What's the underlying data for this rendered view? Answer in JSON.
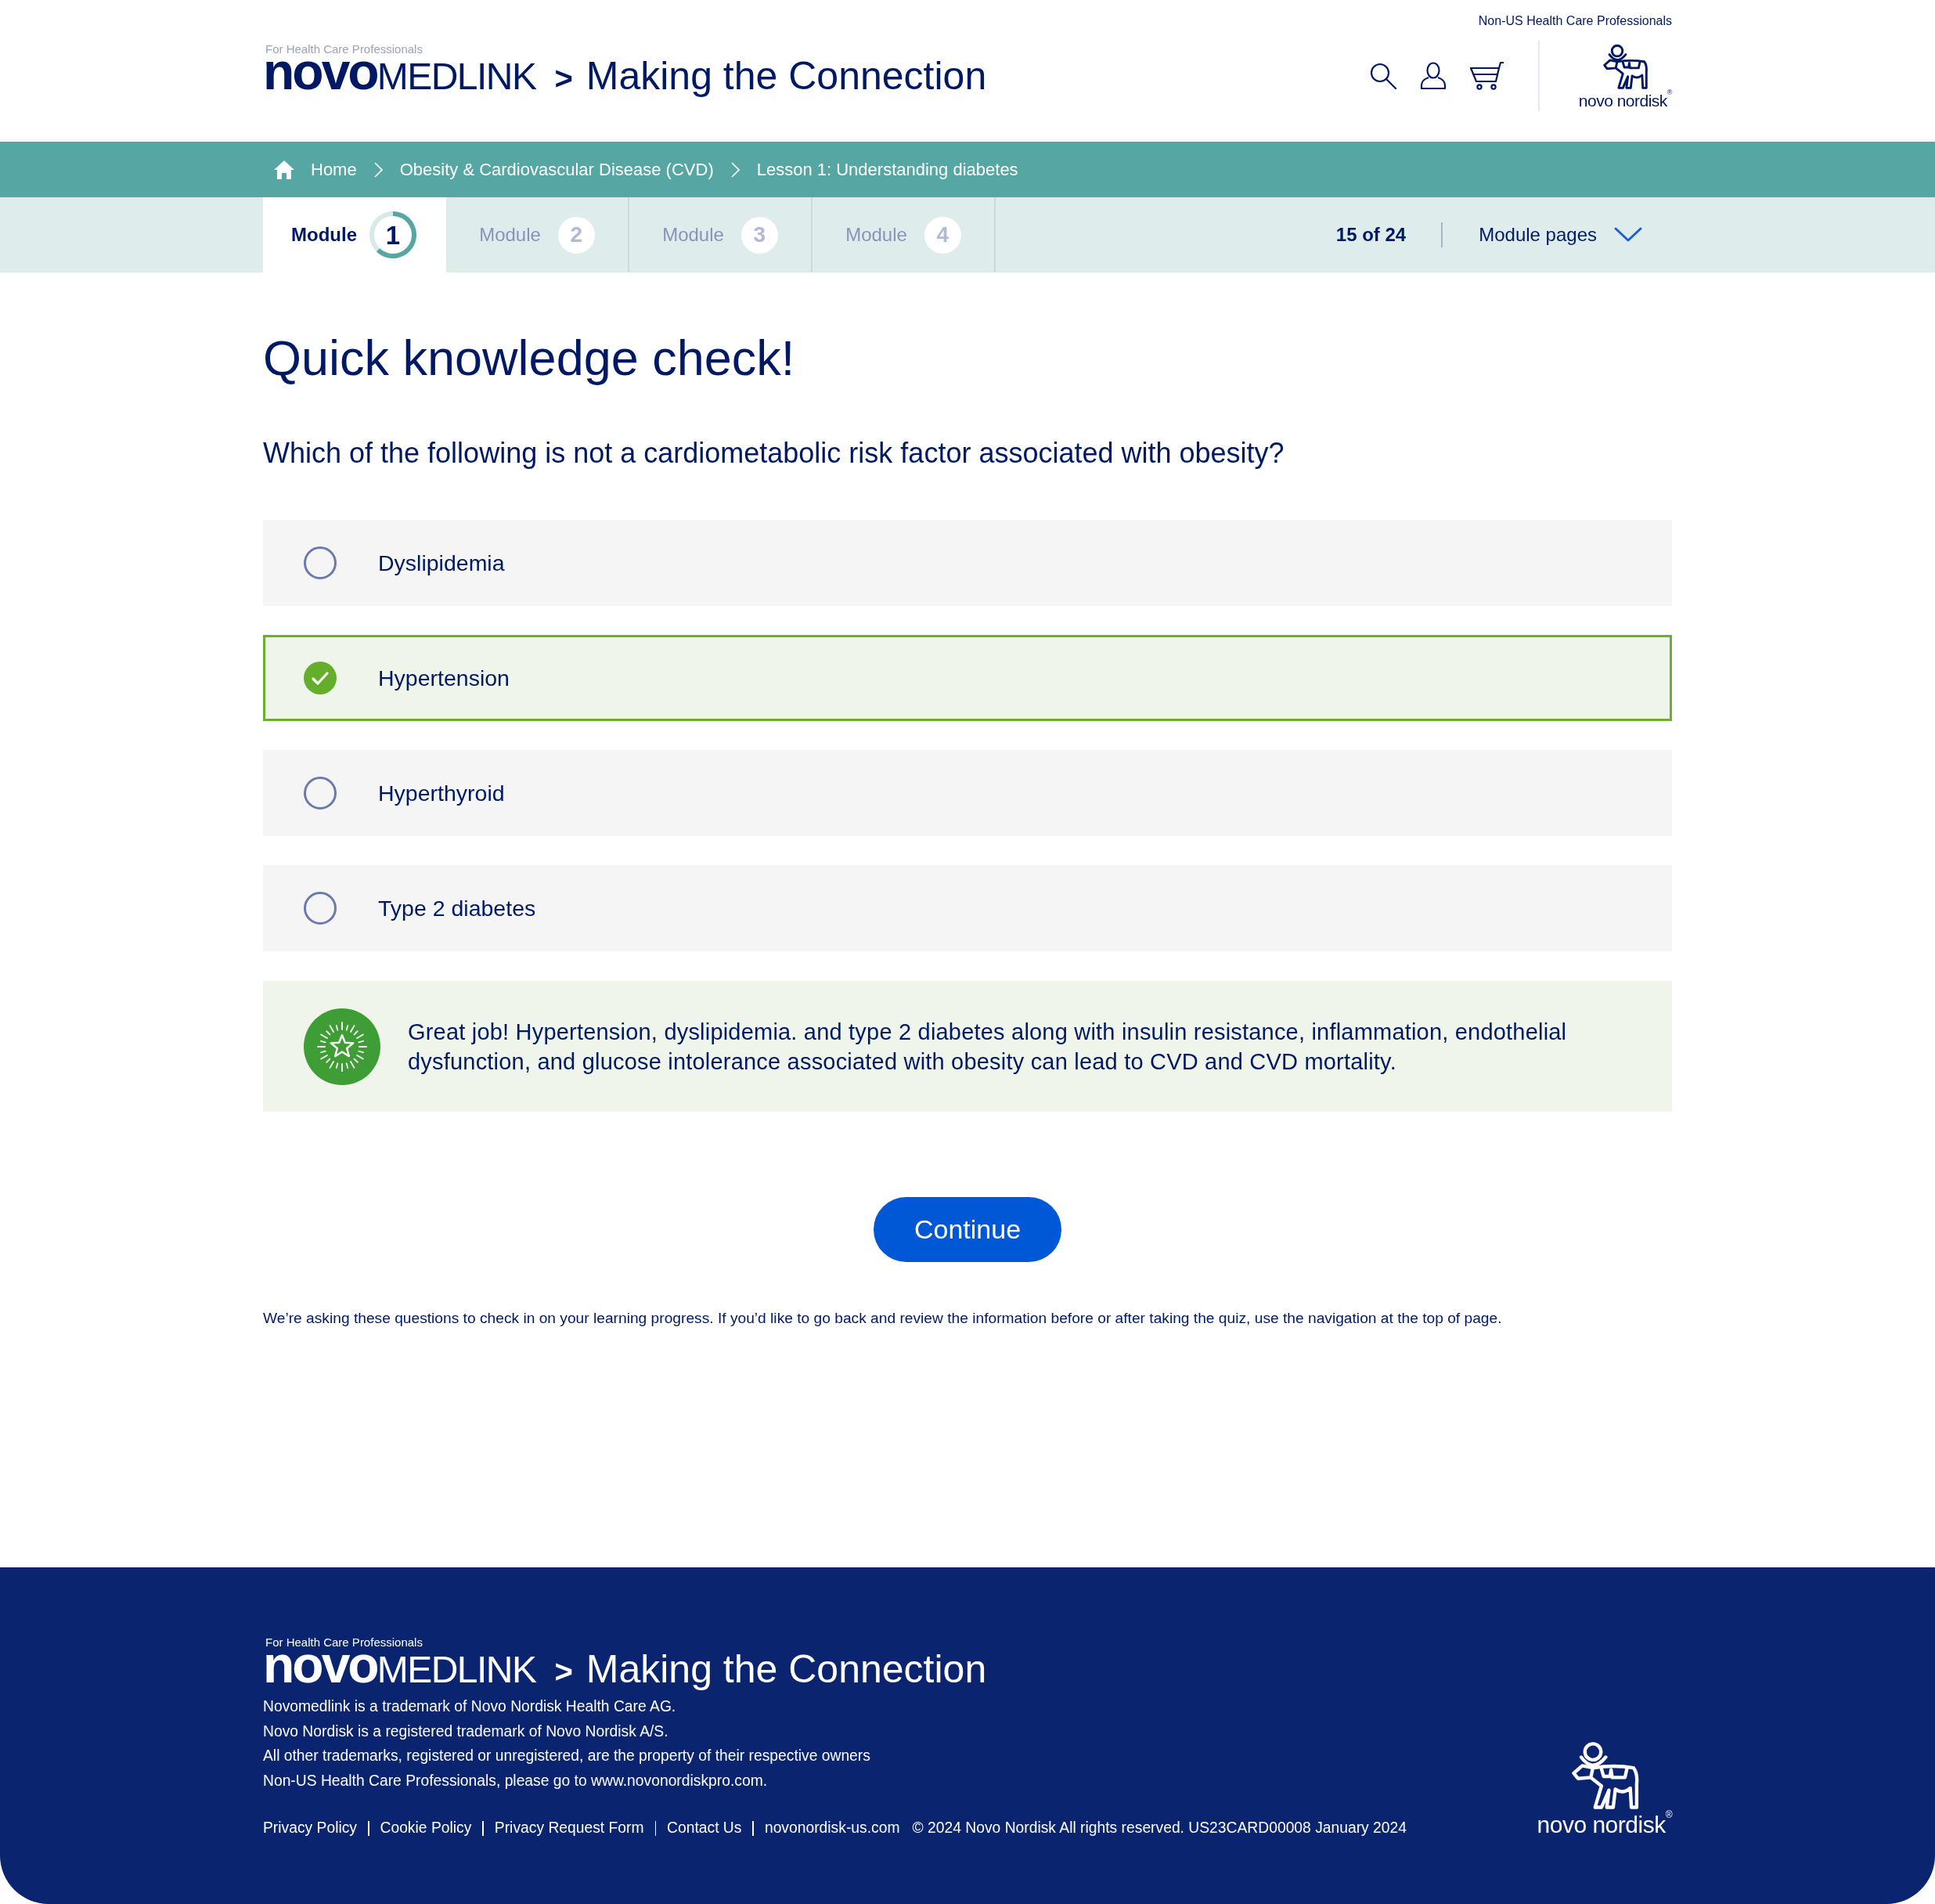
{
  "header": {
    "top_link": "Non-US Health Care Professionals",
    "logo": {
      "tagline": "For Health Care Professionals",
      "brand": "**novo**MEDLINK",
      "title": "**>** Making the Connection"
    },
    "company_logo": "novo nordisk$^{®}$"
  },
  "breadcrumbs": [
    {
      "label": "Home",
      "kind": "home"
    },
    {
      "label": "Obesity & Cardiovascular Disease (CVD)",
      "kind": "link"
    },
    {
      "label": "Lesson 1: Understanding diabetes",
      "kind": "link"
    }
  ],
  "module_tabs": [
    {
      "label": "Module",
      "number": "1",
      "selected": true,
      "chart_data": {
        "type": "donut",
        "values": [
          62.5,
          37.5
        ]
      }
    },
    {
      "label": "Module",
      "number": "2",
      "selected": false
    },
    {
      "label": "Module",
      "number": "3",
      "selected": false
    },
    {
      "label": "Module",
      "number": "4",
      "selected": false
    }
  ],
  "page_counter": "15 of 24",
  "module_pages": {
    "label": "Module pages"
  },
  "quiz": {
    "title": "Quick knowledge check!",
    "question": "Which of the following is not a cardiometabolic risk factor associated with obesity?",
    "options": [
      {
        "label": "Dyslipidemia",
        "selected": false
      },
      {
        "label": "Hypertension",
        "selected": true
      },
      {
        "label": "Hyperthyroid",
        "selected": false
      },
      {
        "label": "Type 2 diabetes",
        "selected": false
      }
    ],
    "feedback": "Great job! Hypertension, dyslipidemia. and type 2 diabetes along with insulin resistance, inflammation, endothelial dysfunction, and glucose intolerance associated with obesity can lead to CVD and CVD mortality.",
    "continue_button": "Continue",
    "note": "We’re asking these questions to check in on your learning progress. If you’d like to go back and review the information before or after taking the quiz, use the navigation at the top of page."
  },
  "footer": {
    "logo": {
      "tagline": "For Health Care Professionals",
      "brand": "**novo**MEDLINK",
      "title": "**>** Making the Connection"
    },
    "lines": [
      "Novomedlink is a trademark of Novo Nordisk Health Care AG.",
      "Novo Nordisk is a registered trademark of Novo Nordisk A/S.",
      "All other trademarks, registered or unregistered, are the property of their respective owners",
      "Non-US Health Care Professionals, please go to www.novonordiskpro.com."
    ],
    "links": [
      "Privacy Policy",
      "Cookie Policy",
      "Privacy Request Form",
      "Contact Us",
      "novonordisk-us.com"
    ],
    "copyright": "© 2024 Novo Nordisk All rights reserved. US23CARD00008 January 2024",
    "company_logo": "novo nordisk$^{®}$"
  }
}
